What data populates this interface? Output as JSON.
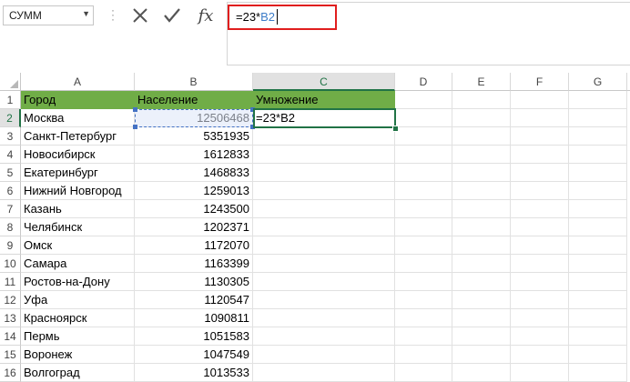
{
  "formula_bar": {
    "name_box": "СУММ",
    "formula_prefix": "=23*",
    "formula_ref": "B2",
    "fx_label": "fx"
  },
  "columns": [
    "A",
    "B",
    "C",
    "D",
    "E",
    "F",
    "G"
  ],
  "selected_column": "C",
  "selected_row": "2",
  "header_row": {
    "row_number": "1",
    "col_a": "Город",
    "col_b": "Население",
    "col_c": "Умножение"
  },
  "rows": [
    {
      "n": "2",
      "city": "Москва",
      "population": "12506468",
      "formula": "=23*B2"
    },
    {
      "n": "3",
      "city": "Санкт-Петербург",
      "population": "5351935",
      "formula": ""
    },
    {
      "n": "4",
      "city": "Новосибирск",
      "population": "1612833",
      "formula": ""
    },
    {
      "n": "5",
      "city": "Екатеринбург",
      "population": "1468833",
      "formula": ""
    },
    {
      "n": "6",
      "city": "Нижний Новгород",
      "population": "1259013",
      "formula": ""
    },
    {
      "n": "7",
      "city": "Казань",
      "population": "1243500",
      "formula": ""
    },
    {
      "n": "8",
      "city": "Челябинск",
      "population": "1202371",
      "formula": ""
    },
    {
      "n": "9",
      "city": "Омск",
      "population": "1172070",
      "formula": ""
    },
    {
      "n": "10",
      "city": "Самара",
      "population": "1163399",
      "formula": ""
    },
    {
      "n": "11",
      "city": "Ростов-на-Дону",
      "population": "1130305",
      "formula": ""
    },
    {
      "n": "12",
      "city": "Уфа",
      "population": "1120547",
      "formula": ""
    },
    {
      "n": "13",
      "city": "Красноярск",
      "population": "1090811",
      "formula": ""
    },
    {
      "n": "14",
      "city": "Пермь",
      "population": "1051583",
      "formula": ""
    },
    {
      "n": "15",
      "city": "Воронеж",
      "population": "1047549",
      "formula": ""
    },
    {
      "n": "16",
      "city": "Волгоград",
      "population": "1013533",
      "formula": ""
    }
  ],
  "colors": {
    "header_fill": "#70ad47",
    "active_border": "#217346",
    "reference_border": "#4472c4",
    "formula_highlight_border": "#e01e1e"
  }
}
